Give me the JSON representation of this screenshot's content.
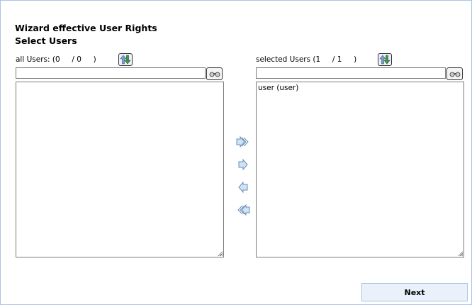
{
  "title": "Wizard effective User Rights",
  "subtitle": "Select Users",
  "left": {
    "label": "all Users: (0     / 0     )",
    "search_value": "",
    "items": []
  },
  "right": {
    "label": "selected Users (1     / 1     )",
    "search_value": "",
    "items": [
      "user (user)"
    ]
  },
  "icons": {
    "sort": "sort-up-down-icon",
    "find": "binoculars-icon",
    "add_all": "double-arrow-right-icon",
    "add": "arrow-right-icon",
    "remove": "arrow-left-icon",
    "remove_all": "double-arrow-left-icon"
  },
  "colors": {
    "accent_border": "#a9c4e4",
    "button_bg": "#eaf1fa",
    "arrow_fill": "#cfe3f5",
    "arrow_stroke": "#6a8fb5"
  },
  "buttons": {
    "next": "Next"
  }
}
